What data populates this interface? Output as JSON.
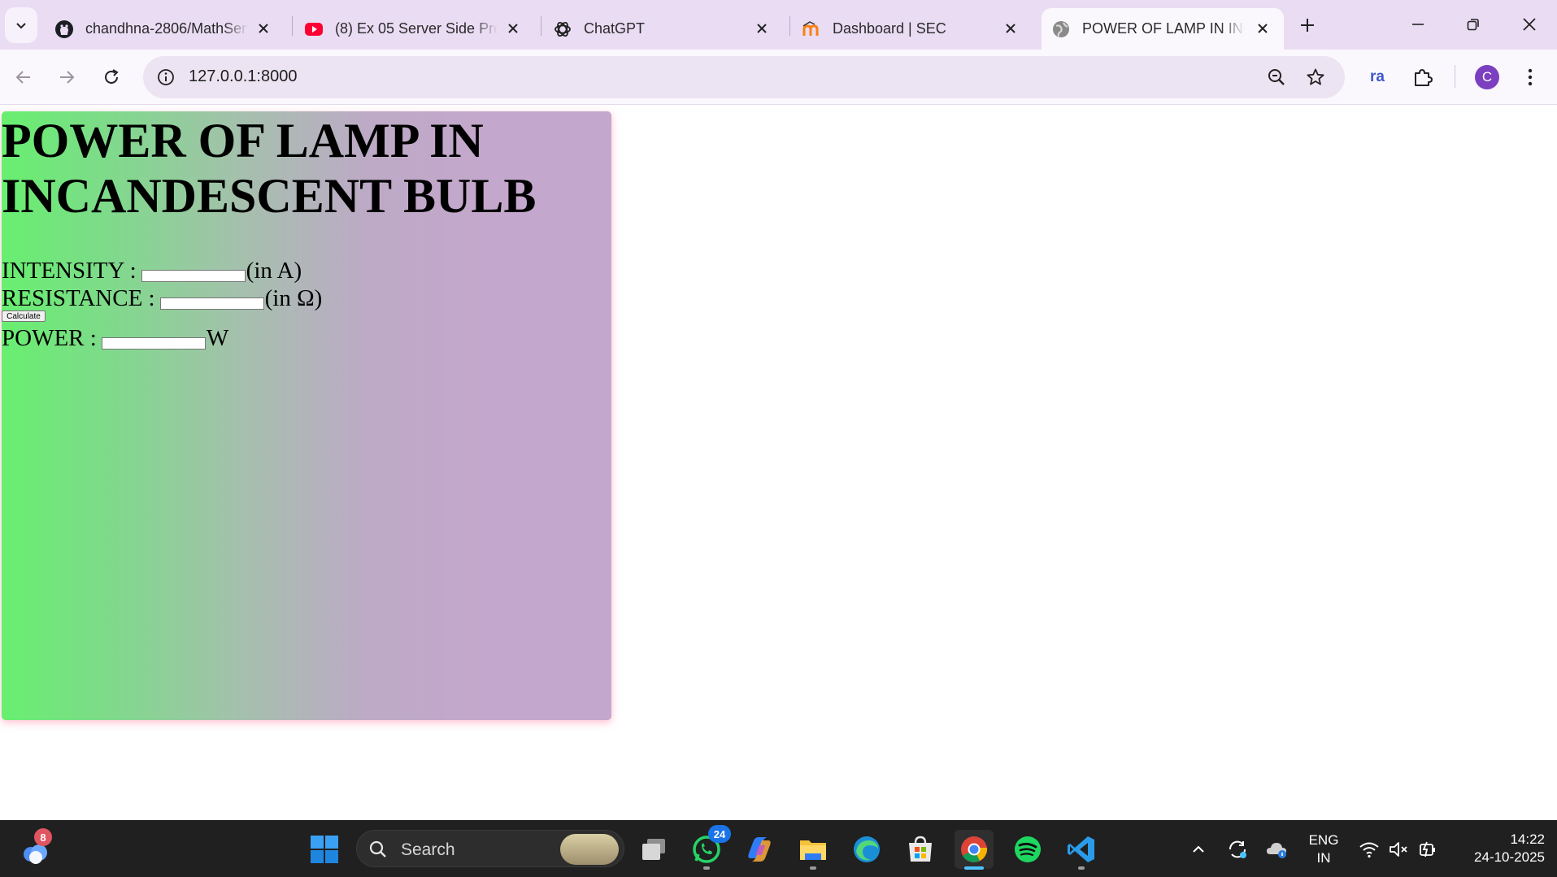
{
  "browser": {
    "tabs": [
      {
        "title": "chandhna-2806/MathServer",
        "favicon": "github-icon"
      },
      {
        "title": "(8) Ex 05 Server Side Processing",
        "favicon": "youtube-icon"
      },
      {
        "title": "ChatGPT",
        "favicon": "chatgpt-icon"
      },
      {
        "title": "Dashboard | SEC",
        "favicon": "moodle-icon"
      },
      {
        "title": "POWER OF LAMP IN INCANDESCENT BULB",
        "favicon": "globe-icon",
        "active": true
      }
    ],
    "address": "127.0.0.1:8000",
    "extension_label": "ra",
    "profile_initial": "C"
  },
  "page": {
    "heading": "POWER OF LAMP IN INCANDESCENT BULB",
    "intensity_label": "INTENSITY :",
    "intensity_value": "",
    "intensity_unit": "(in A)",
    "resistance_label": "RESISTANCE :",
    "resistance_value": "",
    "resistance_unit": "(in Ω)",
    "calculate_label": "Calculate",
    "power_label": "POWER :",
    "power_value": "",
    "power_unit": "W"
  },
  "taskbar": {
    "copilot_badge": "8",
    "search_label": "Search",
    "whatsapp_badge": "24",
    "language_line1": "ENG",
    "language_line2": "IN",
    "time": "14:22",
    "date": "24-10-2025"
  },
  "colors": {
    "tabstrip": "#e9dcf3",
    "toolbar": "#fbf8fd",
    "card_gradient_start": "#68ef70",
    "card_gradient_end": "#c4a7cc",
    "taskbar": "#202020",
    "profile_avatar": "#7b3fbf"
  }
}
